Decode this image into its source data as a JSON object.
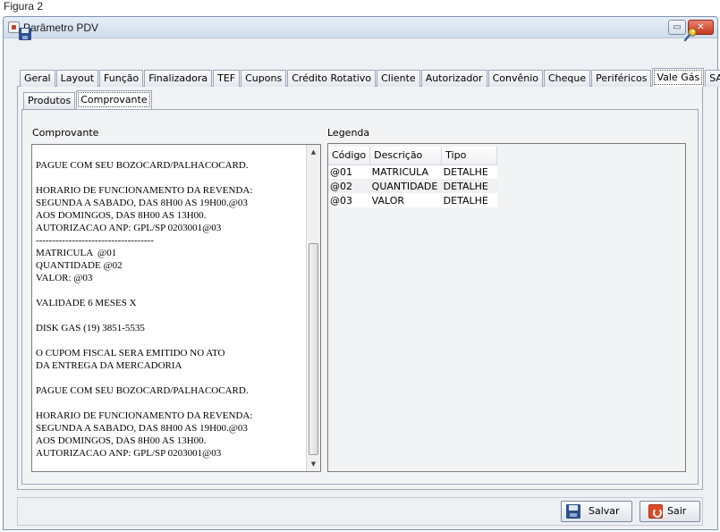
{
  "caption": "Figura 2",
  "window": {
    "title": "Parâmetro PDV",
    "restore_glyph": "▭",
    "close_glyph": "✕"
  },
  "toolbar": {
    "save_icon": "floppy-disk-icon",
    "search_icon": "key-icon"
  },
  "main_tabs": [
    {
      "label": "Geral"
    },
    {
      "label": "Layout"
    },
    {
      "label": "Função"
    },
    {
      "label": "Finalizadora"
    },
    {
      "label": "TEF"
    },
    {
      "label": "Cupons"
    },
    {
      "label": "Crédito Rotativo"
    },
    {
      "label": "Cliente"
    },
    {
      "label": "Autorizador"
    },
    {
      "label": "Convênio"
    },
    {
      "label": "Cheque"
    },
    {
      "label": "Periféricos"
    },
    {
      "label": "Vale Gás",
      "active": true
    },
    {
      "label": "SAT"
    }
  ],
  "sub_tabs": [
    {
      "label": "Produtos"
    },
    {
      "label": "Comprovante",
      "active": true
    }
  ],
  "comprovante": {
    "label": "Comprovante",
    "text": "\nPAGUE COM SEU BOZOCARD/PALHACOCARD.\n\nHORARIO DE FUNCIONAMENTO DA REVENDA:\nSEGUNDA A SABADO, DAS 8H00 AS 19H00.@03\nAOS DOMINGOS, DAS 8H00 AS 13H00.\nAUTORIZACAO ANP: GPL/SP 0203001@03\n------------------------------------\nMATRICULA  @01\nQUANTIDADE @02\nVALOR: @03\n\nVALIDADE 6 MESES X\n\nDISK GAS (19) 3851-5535\n\nO CUPOM FISCAL SERA EMITIDO NO ATO\nDA ENTREGA DA MERCADORIA\n\nPAGUE COM SEU BOZOCARD/PALHACOCARD.\n\nHORARIO DE FUNCIONAMENTO DA REVENDA:\nSEGUNDA A SABADO, DAS 8H00 AS 19H00.@03\nAOS DOMINGOS, DAS 8H00 AS 13H00.\nAUTORIZACAO ANP: GPL/SP 0203001@03",
    "scroll_up": "▲",
    "scroll_down": "▼"
  },
  "legenda": {
    "label": "Legenda",
    "columns": {
      "codigo": "Código",
      "descricao": "Descrição",
      "tipo": "Tipo"
    },
    "rows": [
      {
        "codigo": "@01",
        "descricao": "MATRICULA",
        "tipo": "DETALHE"
      },
      {
        "codigo": "@02",
        "descricao": "QUANTIDADE",
        "tipo": "DETALHE"
      },
      {
        "codigo": "@03",
        "descricao": "VALOR",
        "tipo": "DETALHE"
      }
    ]
  },
  "buttons": {
    "save_label": "Salvar",
    "exit_label": "Sair"
  }
}
